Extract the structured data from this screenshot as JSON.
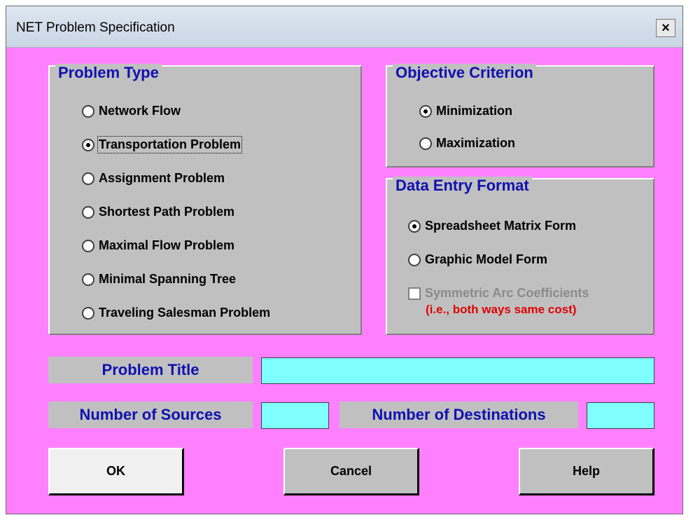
{
  "window": {
    "title": "NET Problem Specification",
    "close_label": "×"
  },
  "problem_type": {
    "title": "Problem Type",
    "options": [
      {
        "label": "Network Flow",
        "checked": false
      },
      {
        "label": "Transportation Problem",
        "checked": true
      },
      {
        "label": "Assignment Problem",
        "checked": false
      },
      {
        "label": "Shortest Path Problem",
        "checked": false
      },
      {
        "label": "Maximal Flow Problem",
        "checked": false
      },
      {
        "label": "Minimal Spanning Tree",
        "checked": false
      },
      {
        "label": "Traveling Salesman Problem",
        "checked": false
      }
    ]
  },
  "objective": {
    "title": "Objective Criterion",
    "options": [
      {
        "label": "Minimization",
        "checked": true
      },
      {
        "label": "Maximization",
        "checked": false
      }
    ]
  },
  "data_entry": {
    "title": "Data Entry Format",
    "options": [
      {
        "label": "Spreadsheet Matrix Form",
        "checked": true
      },
      {
        "label": "Graphic Model Form",
        "checked": false
      }
    ],
    "symmetric_label": "Symmetric Arc Coefficients",
    "symmetric_note": "(i.e., both ways same cost)"
  },
  "fields": {
    "problem_title_label": "Problem Title",
    "problem_title_value": "",
    "sources_label": "Number of Sources",
    "sources_value": "",
    "destinations_label": "Number of Destinations",
    "destinations_value": ""
  },
  "buttons": {
    "ok": "OK",
    "cancel": "Cancel",
    "help": "Help"
  },
  "colors": {
    "dialog_bg": "#ff80ff",
    "panel_bg": "#c0c0c0",
    "heading_blue": "#1010b0",
    "input_bg": "#80ffff",
    "note_red": "#e00000"
  }
}
